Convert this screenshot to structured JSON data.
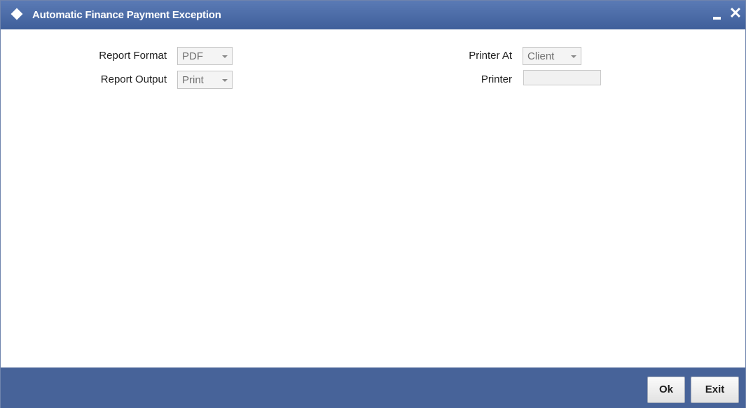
{
  "window": {
    "title": "Automatic Finance Payment Exception",
    "close_glyph": "✕"
  },
  "form": {
    "report_format": {
      "label": "Report Format",
      "value": "PDF"
    },
    "report_output": {
      "label": "Report Output",
      "value": "Print"
    },
    "printer_at": {
      "label": "Printer At",
      "value": "Client"
    },
    "printer": {
      "label": "Printer",
      "value": ""
    }
  },
  "footer": {
    "ok_label": "Ok",
    "exit_label": "Exit"
  },
  "colors": {
    "titlebar": "#476399",
    "footer": "#476399"
  },
  "icons": [
    "diamond-icon",
    "minimize-icon",
    "close-icon",
    "dropdown-arrow-icon"
  ]
}
